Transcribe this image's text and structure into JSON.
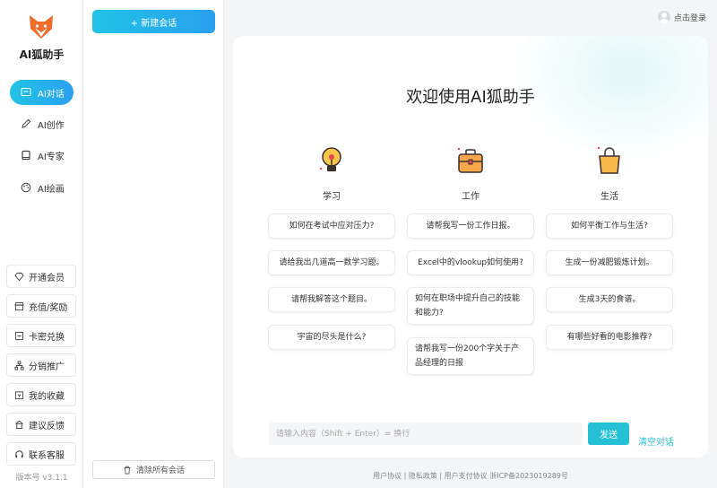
{
  "app": {
    "name": "AI狐助手"
  },
  "nav": [
    {
      "label": "AI对话",
      "icon": "chat-icon",
      "active": true
    },
    {
      "label": "AI创作",
      "icon": "pencil-icon",
      "active": false
    },
    {
      "label": "AI专家",
      "icon": "book-icon",
      "active": false
    },
    {
      "label": "AI绘画",
      "icon": "palette-icon",
      "active": false
    }
  ],
  "side_menu": [
    {
      "label": "开通会员",
      "icon": "diamond-icon"
    },
    {
      "label": "充值/奖励",
      "icon": "shop-icon"
    },
    {
      "label": "卡密兑换",
      "icon": "card-icon"
    },
    {
      "label": "分销推广",
      "icon": "network-icon"
    },
    {
      "label": "我的收藏",
      "icon": "bookmark-icon"
    },
    {
      "label": "建议反馈",
      "icon": "feedback-icon"
    },
    {
      "label": "联系客服",
      "icon": "headset-icon"
    }
  ],
  "version": "版本号 v3.1.1",
  "sessions": {
    "new_chat_label": "+ 新建会话",
    "clear_all_label": "清除所有会话"
  },
  "header": {
    "login_label": "点击登录"
  },
  "main": {
    "welcome": "欢迎使用AI狐助手",
    "columns": [
      {
        "title": "学习",
        "icon": "lightbulb-icon",
        "questions": [
          "如何在考试中应对压力?",
          "请给我出几道高一数学习题。",
          "请帮我解答这个题目。",
          "宇宙的尽头是什么?"
        ]
      },
      {
        "title": "工作",
        "icon": "briefcase-icon",
        "questions": [
          "请帮我写一份工作日报。",
          "Excel中的vlookup如何使用?",
          "如何在职场中提升自己的技能和能力?",
          "请帮我写一份200个字关于产品经理的日报"
        ]
      },
      {
        "title": "生活",
        "icon": "shopping-bag-icon",
        "questions": [
          "如何平衡工作与生活?",
          "生成一份减肥锻炼计划。",
          "生成3天的食谱。",
          "有哪些好看的电影推荐?"
        ]
      }
    ],
    "input_placeholder": "请输入内容（Shift + Enter）= 换行",
    "send_label": "发送",
    "clear_chat_label": "清空对话"
  },
  "footer": "用户协议 | 隐私政策 | 用户支付协议  浙ICP备2023019289号",
  "colors": {
    "accent": "#25bfd6",
    "accent_gradient_end": "#2a9ff0",
    "logo_orange": "#f26b2a"
  }
}
